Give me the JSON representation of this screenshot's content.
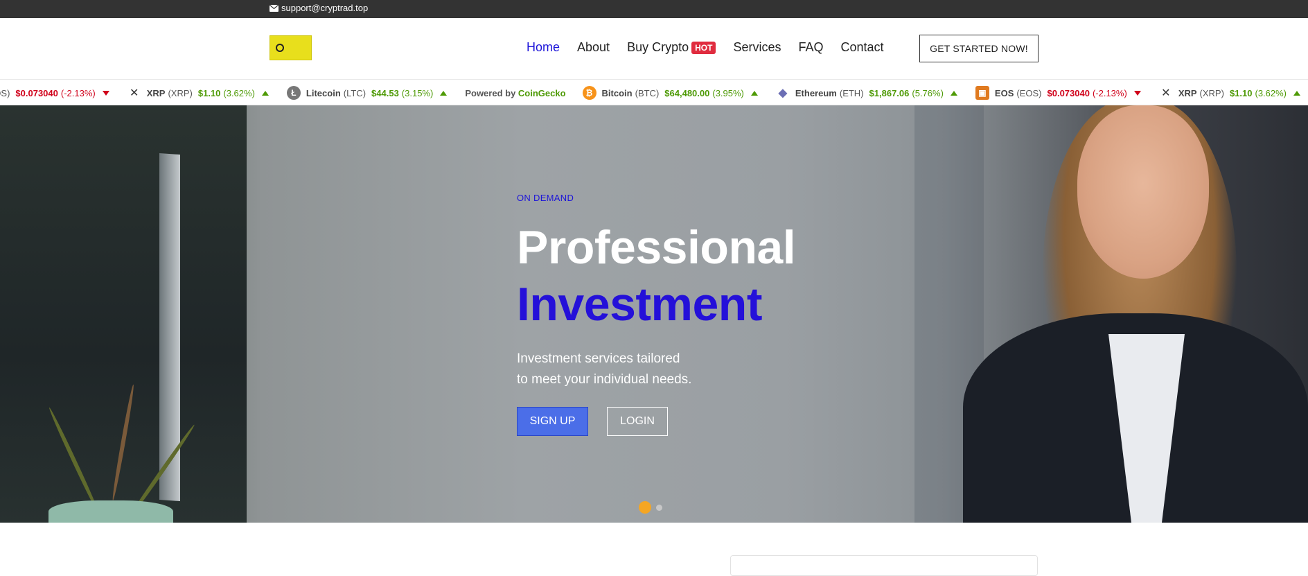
{
  "topbar": {
    "email": "support@cryptrad.top"
  },
  "header": {
    "nav": [
      {
        "label": "Home"
      },
      {
        "label": "About"
      },
      {
        "label": "Buy Crypto",
        "badge": "HOT"
      },
      {
        "label": "Services"
      },
      {
        "label": "FAQ"
      },
      {
        "label": "Contact"
      }
    ],
    "cta_label": "GET STARTED NOW!"
  },
  "ticker": {
    "items": [
      {
        "name": "",
        "symbol": "S (EOS)",
        "price": "$0.073040",
        "change": "(-2.13%)",
        "direction": "down",
        "icon": "eos-icon"
      },
      {
        "name": "XRP",
        "symbol": "(XRP)",
        "price": "$1.10",
        "change": "(3.62%)",
        "direction": "up",
        "icon": "xrp-icon"
      },
      {
        "name": "Litecoin",
        "symbol": "(LTC)",
        "price": "$44.53",
        "change": "(3.15%)",
        "direction": "up",
        "icon": "litecoin-icon"
      },
      {
        "powered_prefix": "Powered by",
        "powered_brand": "CoinGecko"
      },
      {
        "name": "Bitcoin",
        "symbol": "(BTC)",
        "price": "$64,480.00",
        "change": "(3.95%)",
        "direction": "up",
        "icon": "bitcoin-icon"
      },
      {
        "name": "Ethereum",
        "symbol": "(ETH)",
        "price": "$1,867.06",
        "change": "(5.76%)",
        "direction": "up",
        "icon": "ethereum-icon"
      },
      {
        "name": "EOS",
        "symbol": "(EOS)",
        "price": "$0.073040",
        "change": "(-2.13%)",
        "direction": "down",
        "icon": "eos-icon"
      },
      {
        "name": "XRP",
        "symbol": "(XRP)",
        "price": "$1.10",
        "change": "(3.62%)",
        "direction": "up",
        "icon": "xrp-icon"
      }
    ]
  },
  "hero": {
    "tag": "ON DEMAND",
    "title_line1": "Professional",
    "title_line2": "Investment",
    "subtitle_line1": "Investment services tailored",
    "subtitle_line2": "to meet your individual needs.",
    "signup_label": "SIGN UP",
    "login_label": "LOGIN",
    "slides": {
      "count": 2,
      "active": 1
    }
  },
  "colors": {
    "accent": "#1d15d9",
    "hot_badge": "#e02c3f",
    "signup": "#4b6ee8",
    "dot_active": "#f5a623",
    "up": "#4e9a06",
    "down": "#d0021b"
  }
}
